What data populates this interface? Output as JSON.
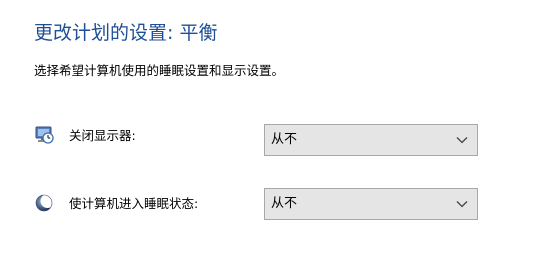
{
  "page": {
    "title": "更改计划的设置: 平衡",
    "subtitle": "选择希望计算机使用的睡眠设置和显示设置。"
  },
  "settings": [
    {
      "label": "关闭显示器:",
      "icon": "monitor-clock-icon",
      "selected": "从不"
    },
    {
      "label": "使计算机进入睡眠状态:",
      "icon": "moon-icon",
      "selected": "从不"
    }
  ],
  "colors": {
    "title": "#1f4f97",
    "select_bg": "#e5e5e5",
    "select_border": "#a8a8a8"
  }
}
